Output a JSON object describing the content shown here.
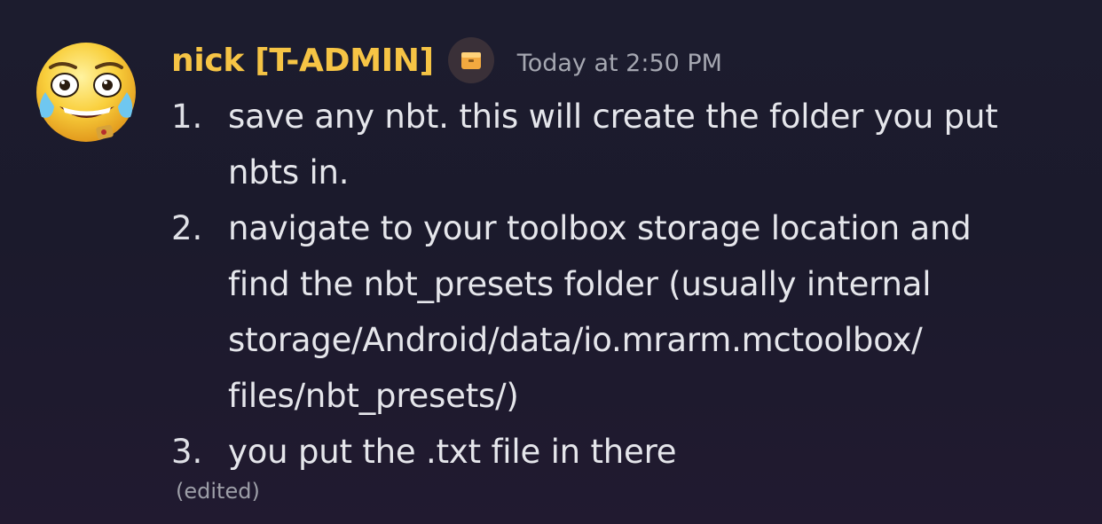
{
  "message": {
    "author": "nick [T-ADMIN]",
    "author_color": "#f6c445",
    "avatar_icon": "joy-tears-emoji-icon",
    "role_icon": "box-icon",
    "timestamp": "Today at 2:50 PM",
    "items": [
      {
        "number": "1.",
        "lines": [
          "save any nbt. this will create the folder you put",
          "nbts in."
        ]
      },
      {
        "number": "2.",
        "lines": [
          "navigate to your toolbox storage location and",
          "find the nbt_presets folder (usually internal",
          "storage/Android/data/io.mrarm.mctoolbox/",
          "files/nbt_presets/)"
        ]
      },
      {
        "number": "3.",
        "lines": [
          "you put the .txt file in there"
        ]
      }
    ],
    "edited_label": "(edited)"
  }
}
